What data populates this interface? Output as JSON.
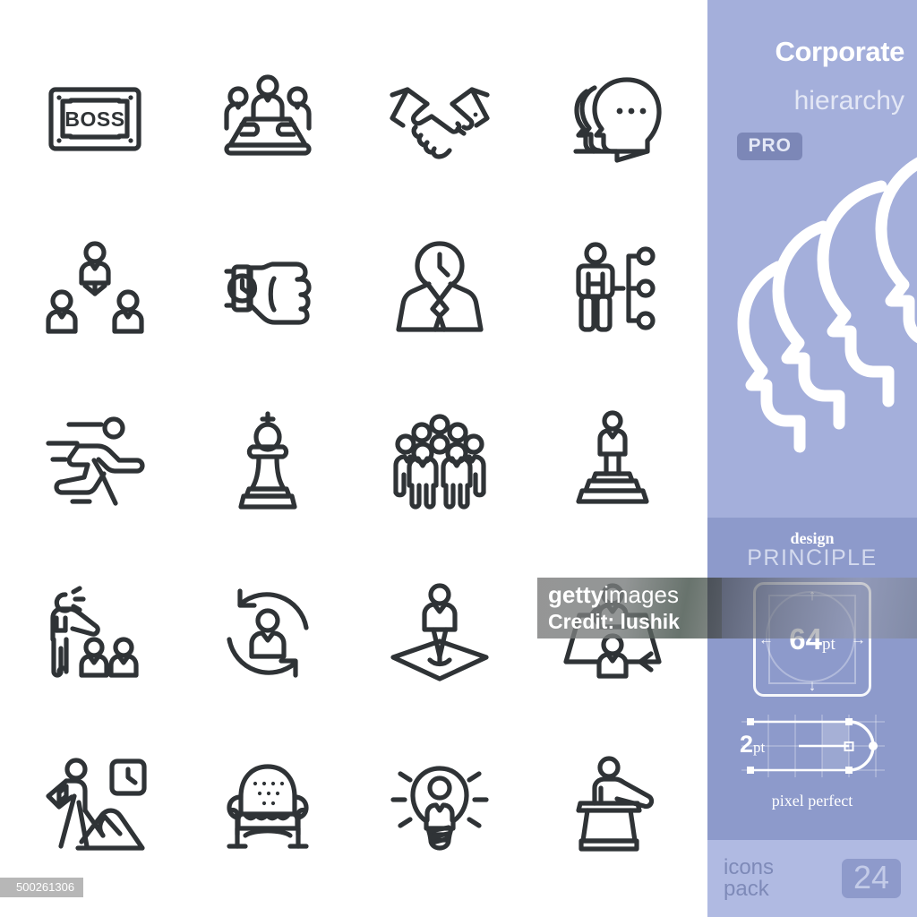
{
  "sidebar": {
    "title": "Corporate",
    "subtitle": "hierarchy",
    "badge": "PRO",
    "design_line1": "design",
    "design_line2": "PRINCIPLE",
    "size_value": "64",
    "size_unit": "pt",
    "stroke_value": "2",
    "stroke_unit": "pt",
    "pixel_perfect": "pixel perfect",
    "pack_label_line1": "icons",
    "pack_label_line2": "pack",
    "pack_count": "24",
    "arrows": {
      "up": "↑",
      "down": "↓",
      "left": "←",
      "right": "→"
    },
    "colors": {
      "panel": "#a4afdb",
      "panel_mid": "#8d9acb",
      "panel_bottom": "#b0bae2",
      "badge": "#7c87b7",
      "white": "#ffffff"
    }
  },
  "watermark": {
    "brand_bold": "getty",
    "brand_light": "images",
    "credit": "Credit: lushik",
    "image_id": "500261306"
  },
  "grid": {
    "columns": 4,
    "rows": 5,
    "stroke_color": "#2f3336",
    "nameplate_text": "BOSS",
    "icons": [
      {
        "name": "boss-nameplate-icon",
        "label": "BOSS nameplate"
      },
      {
        "name": "boardroom-meeting-icon",
        "label": "Boardroom meeting"
      },
      {
        "name": "handshake-icon",
        "label": "Handshake"
      },
      {
        "name": "profile-heads-talking-icon",
        "label": "Profile heads discussion"
      },
      {
        "name": "org-chart-people-icon",
        "label": "Organization chart"
      },
      {
        "name": "fist-wristwatch-icon",
        "label": "Fist with wristwatch"
      },
      {
        "name": "businessman-clock-head-icon",
        "label": "Businessman with clock head"
      },
      {
        "name": "person-hierarchy-nodes-icon",
        "label": "Person with hierarchy nodes"
      },
      {
        "name": "running-businessman-icon",
        "label": "Running businessman"
      },
      {
        "name": "chess-king-icon",
        "label": "Chess king"
      },
      {
        "name": "crowd-of-people-icon",
        "label": "Crowd of people"
      },
      {
        "name": "person-on-pedestal-icon",
        "label": "Person on pedestal"
      },
      {
        "name": "boss-shouting-at-team-icon",
        "label": "Boss directing team"
      },
      {
        "name": "staff-rotation-icon",
        "label": "Person rotation cycle"
      },
      {
        "name": "person-on-platform-icon",
        "label": "Person on platform"
      },
      {
        "name": "staff-replacement-icon",
        "label": "Staff replacement cycle"
      },
      {
        "name": "worker-digging-clock-icon",
        "label": "Worker digging with clock"
      },
      {
        "name": "armchair-icon",
        "label": "Armchair"
      },
      {
        "name": "person-in-lightbulb-icon",
        "label": "Person in lightbulb"
      },
      {
        "name": "speaker-at-podium-icon",
        "label": "Speaker at podium"
      }
    ]
  }
}
